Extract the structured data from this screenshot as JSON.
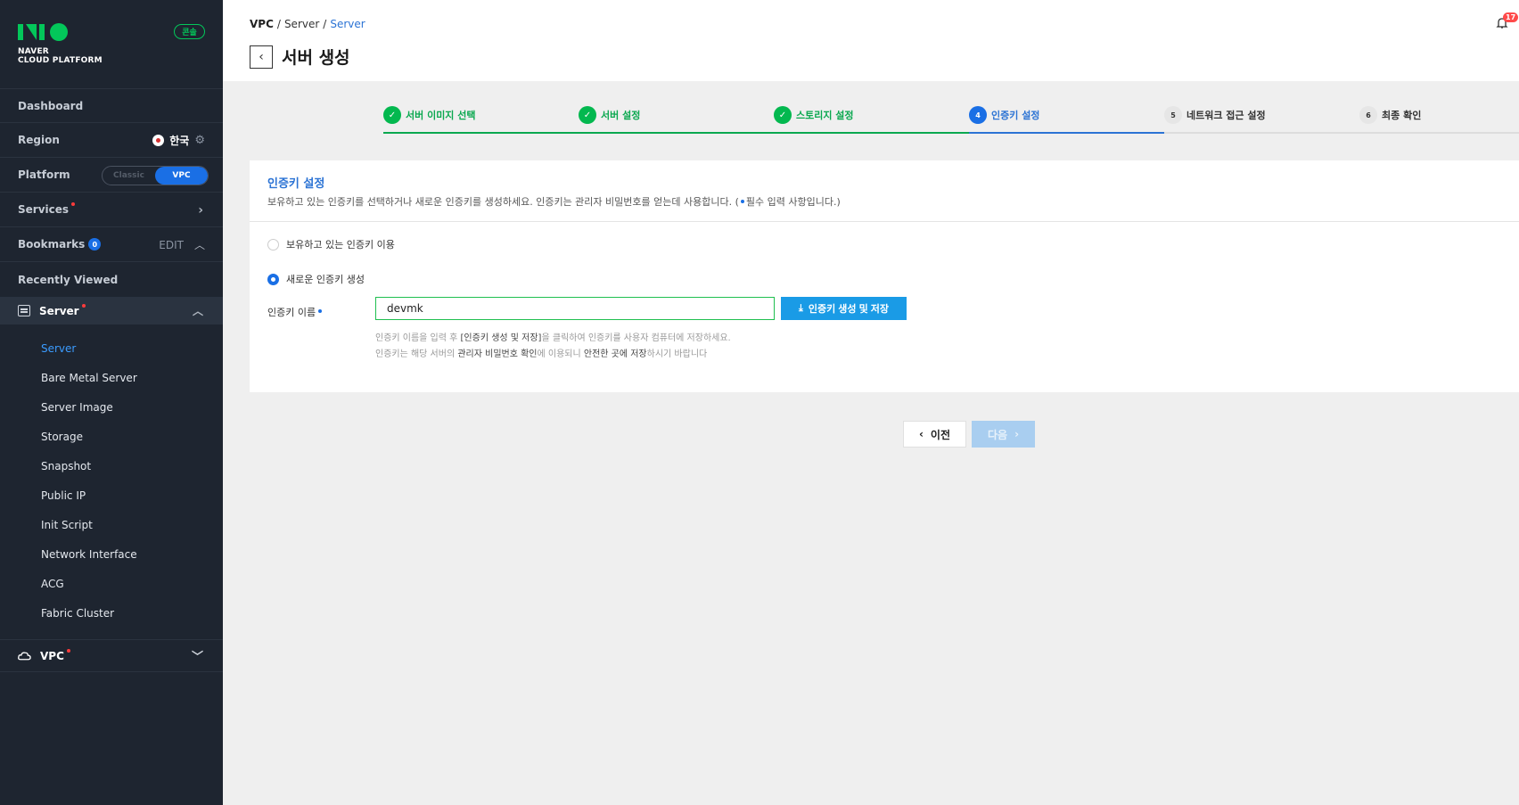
{
  "brand": {
    "line1": "NAVER",
    "line2": "CLOUD PLATFORM",
    "console_badge": "콘솔",
    "accent": "#03c75a"
  },
  "sidebar": {
    "dashboard": "Dashboard",
    "region_label": "Region",
    "region_value": "한국",
    "platform_label": "Platform",
    "platform_options": [
      "Classic",
      "VPC"
    ],
    "platform_selected": "VPC",
    "services": "Services",
    "bookmarks": "Bookmarks",
    "bookmarks_count": "0",
    "bookmarks_edit": "EDIT",
    "recently_viewed": "Recently Viewed",
    "server_section": "Server",
    "server_items": [
      {
        "label": "Server",
        "active": true
      },
      {
        "label": "Bare Metal Server"
      },
      {
        "label": "Server Image"
      },
      {
        "label": "Storage"
      },
      {
        "label": "Snapshot"
      },
      {
        "label": "Public IP"
      },
      {
        "label": "Init Script"
      },
      {
        "label": "Network Interface"
      },
      {
        "label": "ACG"
      },
      {
        "label": "Fabric Cluster"
      }
    ],
    "vpc_section": "VPC"
  },
  "header": {
    "breadcrumb": [
      "VPC",
      "Server",
      "Server"
    ],
    "title": "서버 생성",
    "notification_count": "17"
  },
  "steps": [
    {
      "num": "1",
      "label": "서버 이미지 선택",
      "status": "done"
    },
    {
      "num": "2",
      "label": "서버 설정",
      "status": "done"
    },
    {
      "num": "3",
      "label": "스토리지 설정",
      "status": "done"
    },
    {
      "num": "4",
      "label": "인증키 설정",
      "status": "current"
    },
    {
      "num": "5",
      "label": "네트워크 접근 설정",
      "status": "pending"
    },
    {
      "num": "6",
      "label": "최종 확인",
      "status": "pending"
    }
  ],
  "card": {
    "title": "인증키 설정",
    "description": "보유하고 있는 인증키를 선택하거나 새로운 인증키를 생성하세요. 인증키는 관리자 비밀번호를 얻는데 사용합니다. (",
    "description_req": "필수 입력 사항입니다.)",
    "option_existing": "보유하고 있는 인증키 이용",
    "option_new": "새로운 인증키 생성",
    "selected_option": "new",
    "field_label": "인증키 이름",
    "field_value": "devmk",
    "generate_button": "인증키 생성 및 저장",
    "hint1_a": "인증키 이름을 입력 후 ",
    "hint1_b": "[인증키 생성 및 저장]",
    "hint1_c": "을 클릭하여 인증키를 사용자 컴퓨터에 저장하세요.",
    "hint2_a": "인증키는 해당 서버의 ",
    "hint2_b": "관리자 비밀번호 확인",
    "hint2_c": "에 이용되니 ",
    "hint2_d": "안전한 곳에 저장",
    "hint2_e": "하시기 바랍니다"
  },
  "nav": {
    "prev": "이전",
    "next": "다음"
  }
}
